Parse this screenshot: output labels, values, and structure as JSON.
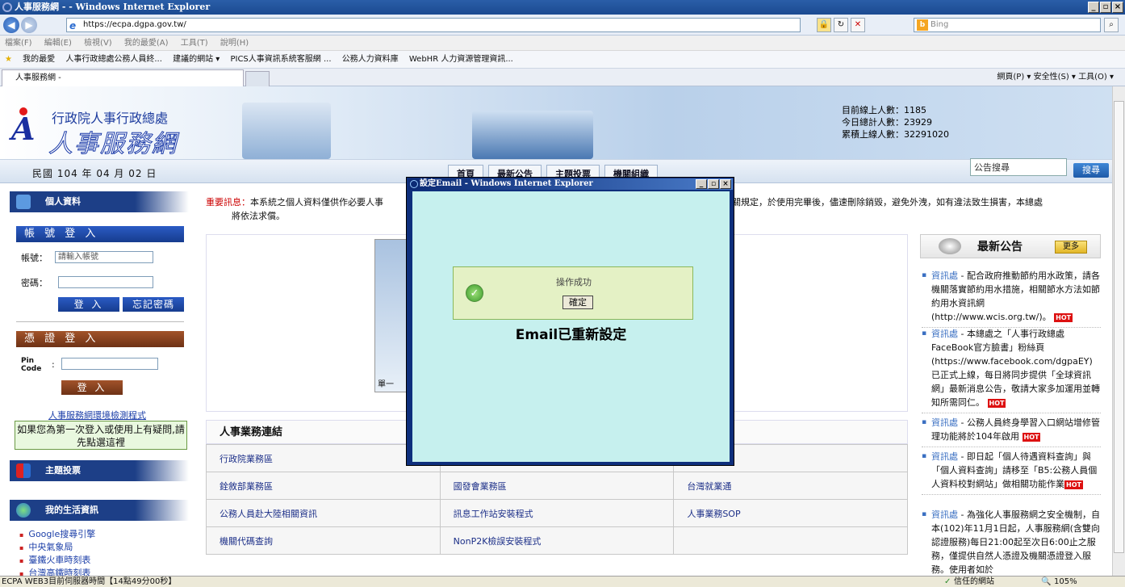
{
  "browser": {
    "title": "人事服務網 - - Windows Internet Explorer",
    "url": "https://ecpa.dgpa.gov.tw/",
    "search_placeholder": "Bing",
    "menu": [
      "檔案(F)",
      "編輯(E)",
      "檢視(V)",
      "我的最愛(A)",
      "工具(T)",
      "說明(H)"
    ],
    "favorites": [
      "我的最愛",
      "人事行政總處公務人員終...",
      "建議的網站 ▾",
      "PICS人事資訊系統客服網 ...",
      "公務人力資料庫",
      "WebHR 人力資源管理資訊..."
    ],
    "tab_label": "人事服務網 -",
    "tools": "網頁(P) ▾  安全性(S) ▾  工具(O) ▾",
    "status": "ECPA WEB3目前伺服器時間【14點49分00秒】",
    "zone": "信任的網站",
    "zoom": "105%"
  },
  "header": {
    "org": "行政院人事行政總處",
    "brand": "人事服務網",
    "stats": [
      "目前線上人數：1185",
      "今日總計人數：23929",
      "累積上線人數：32291020"
    ],
    "date": "民國 104 年 04 月 02 日",
    "nav": [
      "首頁",
      "最新公告",
      "主題投票",
      "機關組織"
    ],
    "search_value": "公告搜尋",
    "search_button": "搜尋"
  },
  "sidebar": {
    "personal_title": "個人資料",
    "account_login": "帳 號 登 入",
    "account_label": "帳號：",
    "account_placeholder": "請輸入帳號",
    "password_label": "密碼：",
    "login_button": "登 入",
    "forgot_button": "忘記密碼",
    "cert_login": "憑 證 登 入",
    "pin_label": "Pin Code",
    "cert_login_button": "登 入",
    "env_link": "人事服務網環境檢測程式",
    "first_time": "如果您為第一次登入或使用上有疑問,請先點選這裡",
    "vote_title": "主題投票",
    "life_title": "我的生活資訊",
    "life_items": [
      "Google搜尋引擎",
      "中央氣象局",
      "臺鐵火車時刻表",
      "台灣高鐵時刻表"
    ]
  },
  "main": {
    "notice_label": "重要訊息：",
    "notice_text": "本系統之個人資料僅供作必要人事",
    "notice_text2": "之相關規定，於使用完畢後，儘速刪除銷毀，避免外洩，如有違法致生損害，本總處",
    "notice_text3": "將依法求償。",
    "content_fragment": "單一",
    "links_title": "人事業務連結",
    "links": [
      [
        "行政院業務區",
        "",
        "區"
      ],
      [
        "銓敘部業務區",
        "國發會業務區",
        "台灣就業通"
      ],
      [
        "公務人員赴大陸相關資訊",
        "訊息工作站安裝程式",
        "人事業務SOP"
      ],
      [
        "機關代碼查詢",
        "NonP2K檢誤安裝程式",
        ""
      ]
    ]
  },
  "news": {
    "title": "最新公告",
    "more": "更多",
    "hot": "HOT",
    "items": [
      {
        "src": "資訊處",
        "text": " - 配合政府推動節約用水政策，請各機關落實節約用水措施，相關節水方法如節約用水資訊網(http://www.wcis.org.tw/)。"
      },
      {
        "src": "資訊處",
        "text": " - 本總處之「人事行政總處FaceBook官方臉書」粉絲頁(https://www.facebook.com/dgpaEY)已正式上線，每日將同步提供「全球資訊網」最新消息公告，敬請大家多加運用並轉知所需同仁。"
      },
      {
        "src": "資訊處",
        "text": " - 公務人員終身學習入口網站增修管理功能將於104年啟用"
      },
      {
        "src": "資訊處",
        "text": " - 即日起「個人待遇資料查詢」與「個人資料查詢」請移至「B5:公務人員個人資料校對網站」做相關功能作業"
      },
      {
        "src": "資訊處",
        "text": " - 為強化人事服務網之安全機制，自本(102)年11月1日起，人事服務網(含雙向認證服務)每日21:00起至次日6:00止之服務，僅提供自然人憑證及機關憑證登入服務。使用者如於"
      }
    ]
  },
  "popup": {
    "title": "設定Email - Windows Internet Explorer",
    "message": "操作成功",
    "ok_button": "確定",
    "result": "Email已重新設定"
  }
}
